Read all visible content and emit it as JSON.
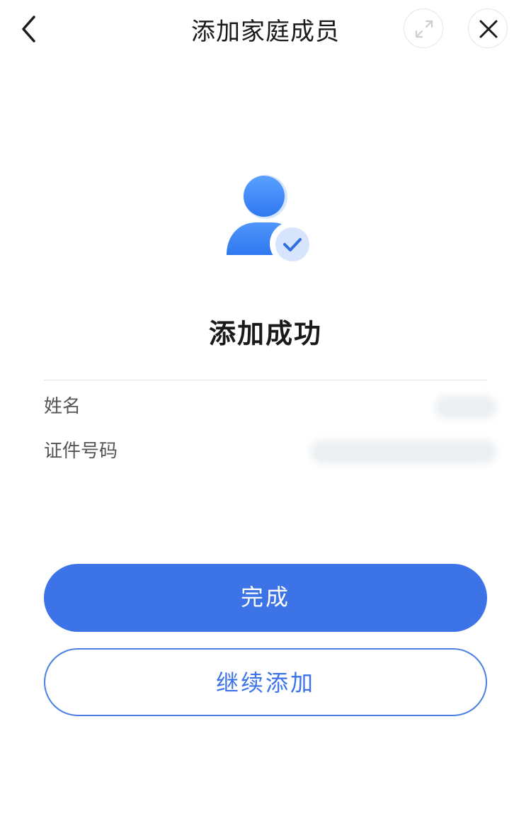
{
  "header": {
    "title": "添加家庭成员"
  },
  "status": {
    "title": "添加成功"
  },
  "info": {
    "name_label": "姓名",
    "id_label": "证件号码"
  },
  "actions": {
    "done_label": "完成",
    "continue_label": "继续添加"
  },
  "colors": {
    "primary": "#3c73e6",
    "avatar_blue": "#3f86f5",
    "text": "#1a1a1a",
    "label": "#555555"
  },
  "icons": {
    "back": "chevron-left-icon",
    "expand": "expand-icon",
    "close": "close-icon",
    "success": "user-check-icon"
  }
}
